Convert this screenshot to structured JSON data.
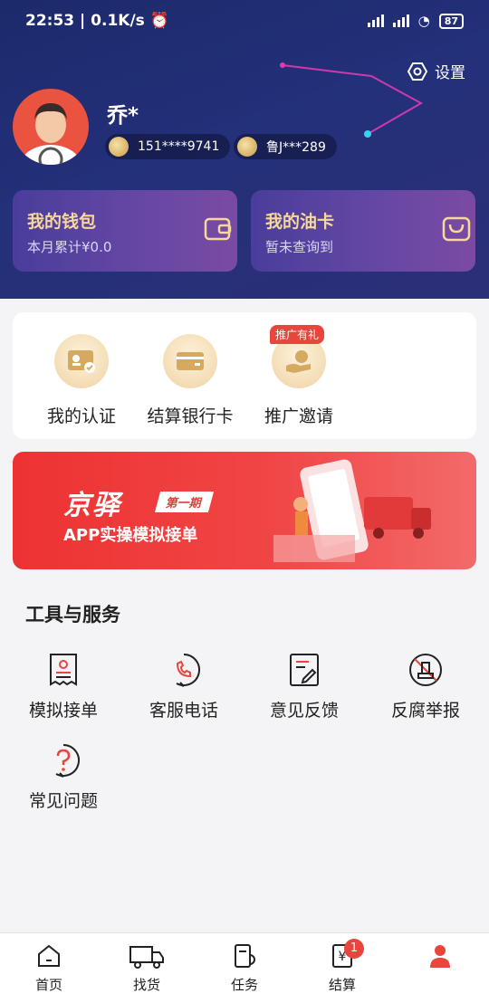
{
  "status_bar": {
    "time": "22:53",
    "speed": "0.1K/s",
    "battery": "87"
  },
  "header": {
    "settings_label": "设置",
    "user_name": "乔*",
    "phone": "151****9741",
    "plate": "鲁J***289"
  },
  "cards": [
    {
      "title": "我的钱包",
      "subtitle": "本月累计¥0.0"
    },
    {
      "title": "我的油卡",
      "subtitle": "暂未查询到"
    }
  ],
  "quick_actions": [
    {
      "label": "我的认证"
    },
    {
      "label": "结算银行卡"
    },
    {
      "label": "推广邀请",
      "badge": "推广有礼"
    }
  ],
  "banner": {
    "title": "京驿",
    "tag": "第一期",
    "subtitle": "APP实操模拟接单"
  },
  "tools": {
    "title": "工具与服务",
    "items": [
      {
        "label": "模拟接单",
        "icon": "receipt-icon"
      },
      {
        "label": "客服电话",
        "icon": "phone-icon"
      },
      {
        "label": "意见反馈",
        "icon": "feedback-icon"
      },
      {
        "label": "反腐举报",
        "icon": "report-icon"
      },
      {
        "label": "常见问题",
        "icon": "question-icon"
      }
    ]
  },
  "tabbar": [
    {
      "label": "首页",
      "icon": "home-icon"
    },
    {
      "label": "找货",
      "icon": "truck-icon"
    },
    {
      "label": "任务",
      "icon": "task-icon"
    },
    {
      "label": "结算",
      "icon": "settlement-icon",
      "badge": "1"
    },
    {
      "label": "",
      "icon": "profile-icon"
    }
  ],
  "colors": {
    "accent": "#e8453c",
    "header": "#23307a",
    "gold": "#f8d89a"
  }
}
